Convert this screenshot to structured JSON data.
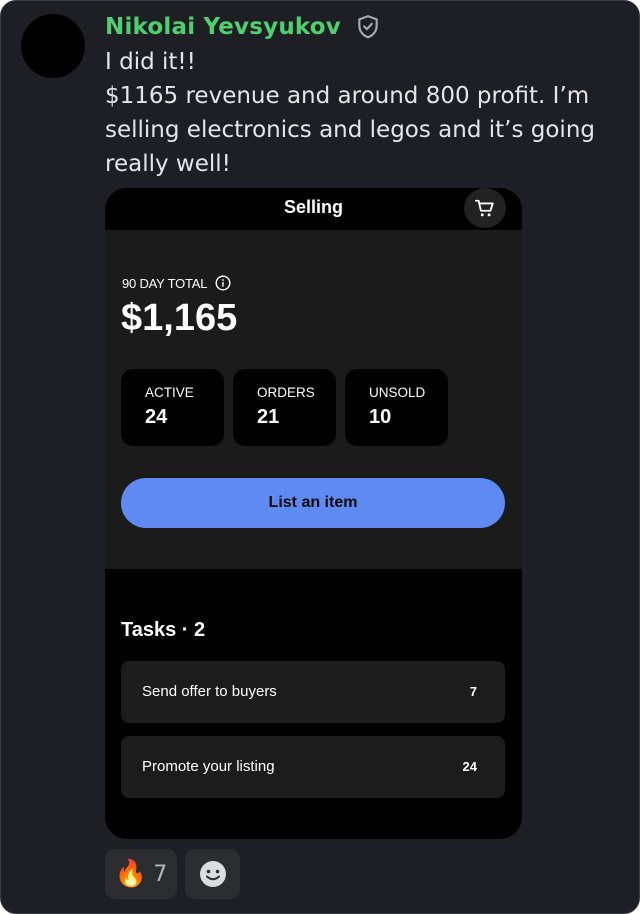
{
  "message": {
    "author": "Nikolai Yevsyukov",
    "badge_icon": "shield-check-icon",
    "lines": [
      "I did it!!",
      "$1165 revenue and around 800 profit. I’m",
      "selling electronics and legos and it’s going",
      "really well!"
    ]
  },
  "screenshot": {
    "header_title": "Selling",
    "cart_icon": "cart-icon",
    "total_label": "90 DAY TOTAL",
    "info_icon": "info-icon",
    "total_value": "$1,165",
    "stats": [
      {
        "label": "ACTIVE",
        "value": "24"
      },
      {
        "label": "ORDERS",
        "value": "21"
      },
      {
        "label": "UNSOLD",
        "value": "10"
      }
    ],
    "list_button": "List an item",
    "tasks_title": "Tasks · 2",
    "tasks": [
      {
        "label": "Send offer to buyers",
        "count": "7"
      },
      {
        "label": "Promote your listing",
        "count": "24"
      }
    ]
  },
  "reactions": {
    "fire_emoji": "🔥",
    "fire_count": "7",
    "add_reaction_icon": "smiley-add-reaction-icon"
  },
  "colors": {
    "background": "#1e1f24",
    "author_name": "#4fcf6f",
    "primary_button": "#5f8af3",
    "text": "#e4e5e8"
  }
}
